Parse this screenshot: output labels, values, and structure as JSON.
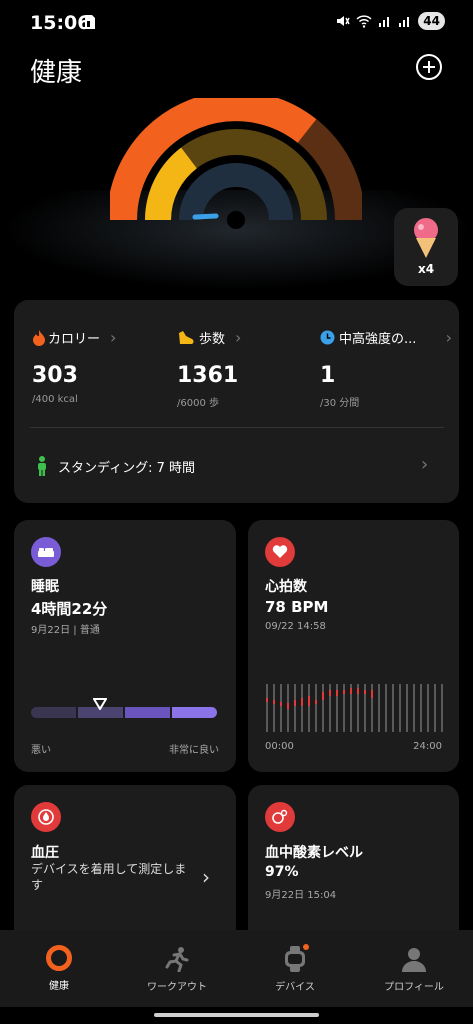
{
  "status_bar": {
    "time": "15:06",
    "battery": "44"
  },
  "header": {
    "title": "健康"
  },
  "badge": {
    "count": "x4"
  },
  "stats": {
    "calories": {
      "label": "カロリー",
      "value": "303",
      "goal": "/400 kcal"
    },
    "steps": {
      "label": "歩数",
      "value": "1361",
      "goal": "/6000 歩"
    },
    "intensity": {
      "label": "中高強度の...",
      "value": "1",
      "goal": "/30 分間"
    },
    "standing": {
      "label": "スタンディング: 7 時間"
    }
  },
  "sleep": {
    "title": "睡眠",
    "duration": "4時間22分",
    "date_quality": "9月22日 | 普通",
    "scale_low": "悪い",
    "scale_high": "非常に良い"
  },
  "heart_rate": {
    "title": "心拍数",
    "value": "78 BPM",
    "timestamp": "09/22 14:58",
    "axis_start": "00:00",
    "axis_end": "24:00"
  },
  "blood_pressure": {
    "title": "血圧",
    "description": "デバイスを着用して測定します"
  },
  "blood_oxygen": {
    "title": "血中酸素レベル",
    "value": "97%",
    "timestamp": "9月22日 15:04"
  },
  "nav": {
    "health": "健康",
    "workout": "ワークアウト",
    "device": "デバイス",
    "profile": "プロフィール"
  },
  "colors": {
    "calories": "#f2621e",
    "steps": "#f4b614",
    "intensity": "#3aa0e8",
    "sleep": "#7a5cd6",
    "heart": "#e03a3a",
    "standing": "#3fbf4e"
  }
}
